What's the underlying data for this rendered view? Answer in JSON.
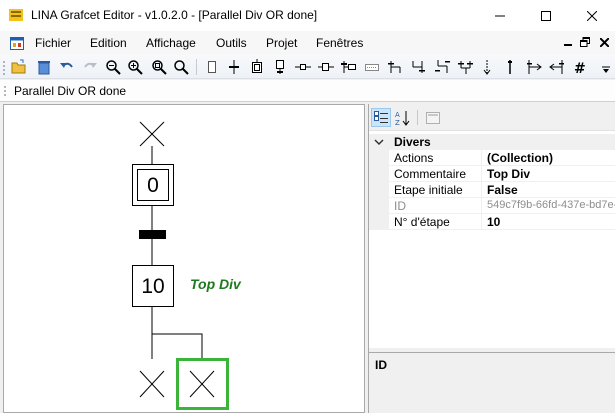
{
  "window": {
    "title": "LINA Grafcet Editor - v1.0.2.0 - [Parallel Div OR done]",
    "app_icon": "lina-app-icon",
    "controls": [
      "minimize-icon",
      "maximize-icon",
      "close-icon"
    ]
  },
  "menu": {
    "items": [
      "Fichier",
      "Edition",
      "Affichage",
      "Outils",
      "Projet",
      "Fenêtres"
    ],
    "mdi_controls": [
      "mdi-minimize-icon",
      "mdi-restore-icon",
      "mdi-close-icon"
    ]
  },
  "toolbar": {
    "icons": [
      "open-folder-icon",
      "delete-icon",
      "undo-icon",
      "redo-icon",
      "zoom-out-icon",
      "zoom-in-icon",
      "zoom-fit-icon",
      "zoom-reset-icon",
      "step-icon",
      "transition-icon",
      "initial-step-icon",
      "macro-step-icon",
      "link-icon",
      "comment-icon",
      "label-icon",
      "divergence-and-icon",
      "convergence-and-icon",
      "divergence-or-icon",
      "convergence-or-icon",
      "jump-icon",
      "vertical-link-icon",
      "goto-icon",
      "return-icon",
      "grid-icon",
      "overflow-icon"
    ]
  },
  "document": {
    "tab_label": "Parallel Div OR done"
  },
  "grafcet": {
    "steps": [
      {
        "number": "0"
      },
      {
        "number": "10",
        "comment": "Top Div"
      }
    ],
    "comment_color": "#1e7a1e",
    "selection_color": "#3ab53a"
  },
  "properties": {
    "toolbar_icons": [
      "categorized-icon",
      "alphabetical-icon",
      "property-pages-icon"
    ],
    "category": "Divers",
    "rows": [
      {
        "name": "Actions",
        "value": "(Collection)",
        "readonly": false
      },
      {
        "name": "Commentaire",
        "value": "Top Div",
        "readonly": false
      },
      {
        "name": "Etape initiale",
        "value": "False",
        "readonly": false
      },
      {
        "name": "ID",
        "value": "549c7f9b-66fd-437e-bd7e-",
        "readonly": true
      },
      {
        "name": "N° d'étape",
        "value": "10",
        "readonly": false
      }
    ],
    "description_title": "ID"
  }
}
